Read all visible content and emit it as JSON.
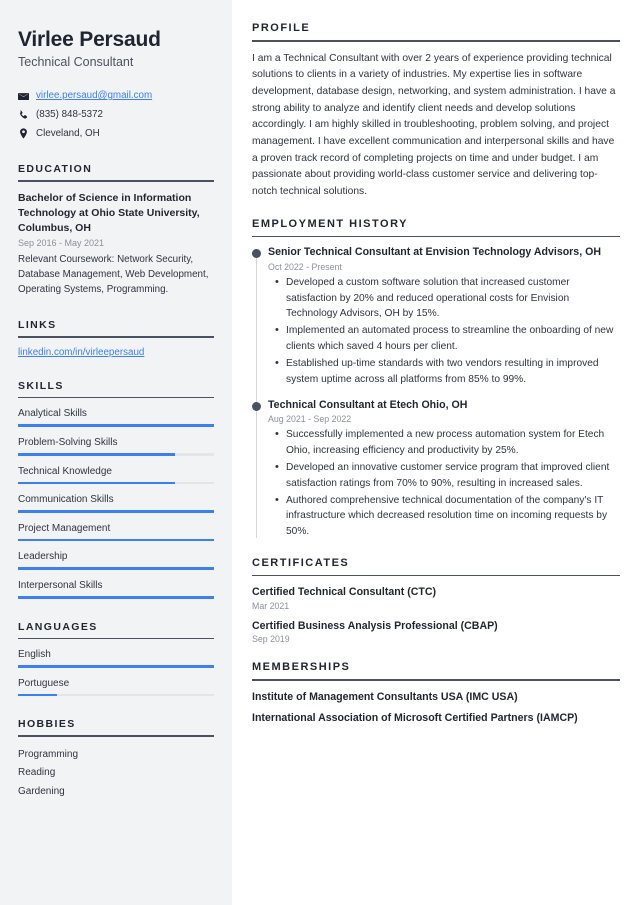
{
  "accent_color": "#3b7ff0",
  "sidebar_bg": "#f2f3f5",
  "text_color": "#2e3440",
  "header": {
    "name": "Virlee Persaud",
    "job_title": "Technical Consultant"
  },
  "contact": {
    "email": "virlee.persaud@gmail.com",
    "email_icon": "envelope-icon",
    "phone": "(835) 848-5372",
    "phone_icon": "phone-icon",
    "location": "Cleveland, OH",
    "location_icon": "map-pin-icon"
  },
  "education": {
    "heading": "EDUCATION",
    "degree": "Bachelor of Science in Information Technology at Ohio State University, Columbus, OH",
    "date": "Sep 2016 - May 2021",
    "description": "Relevant Coursework: Network Security, Database Management, Web Development, Operating Systems, Programming."
  },
  "links": {
    "heading": "LINKS",
    "items": [
      {
        "label": "linkedin.com/in/virleepersaud"
      }
    ]
  },
  "skills": {
    "heading": "SKILLS",
    "items": [
      {
        "label": "Analytical Skills",
        "level": 100
      },
      {
        "label": "Problem-Solving Skills",
        "level": 80
      },
      {
        "label": "Technical Knowledge",
        "level": 80
      },
      {
        "label": "Communication Skills",
        "level": 100
      },
      {
        "label": "Project Management",
        "level": 100
      },
      {
        "label": "Leadership",
        "level": 100
      },
      {
        "label": "Interpersonal Skills",
        "level": 100
      }
    ]
  },
  "languages": {
    "heading": "LANGUAGES",
    "items": [
      {
        "label": "English",
        "level": 100
      },
      {
        "label": "Portuguese",
        "level": 20
      }
    ]
  },
  "hobbies": {
    "heading": "HOBBIES",
    "items": [
      {
        "label": "Programming"
      },
      {
        "label": "Reading"
      },
      {
        "label": "Gardening"
      }
    ]
  },
  "profile": {
    "heading": "PROFILE",
    "text": "I am a Technical Consultant with over 2 years of experience providing technical solutions to clients in a variety of industries. My expertise lies in software development, database design, networking, and system administration. I have a strong ability to analyze and identify client needs and develop solutions accordingly. I am highly skilled in troubleshooting, problem solving, and project management. I have excellent communication and interpersonal skills and have a proven track record of completing projects on time and under budget. I am passionate about providing world-class customer service and delivering top-notch technical solutions."
  },
  "employment": {
    "heading": "EMPLOYMENT HISTORY",
    "jobs": [
      {
        "title": "Senior Technical Consultant at Envision Technology Advisors, OH",
        "date": "Oct 2022 - Present",
        "bullets": [
          "Developed a custom software solution that increased customer satisfaction by 20% and reduced operational costs for Envision Technology Advisors, OH by 15%.",
          "Implemented an automated process to streamline the onboarding of new clients which saved 4 hours per client.",
          "Established up-time standards with two vendors resulting in improved system uptime across all platforms from 85% to 99%."
        ]
      },
      {
        "title": "Technical Consultant at Etech Ohio, OH",
        "date": "Aug 2021 - Sep 2022",
        "bullets": [
          "Successfully implemented a new process automation system for Etech Ohio, increasing efficiency and productivity by 25%.",
          "Developed an innovative customer service program that improved client satisfaction ratings from 70% to 90%, resulting in increased sales.",
          "Authored comprehensive technical documentation of the company's IT infrastructure which decreased resolution time on incoming requests by 50%."
        ]
      }
    ]
  },
  "certificates": {
    "heading": "CERTIFICATES",
    "items": [
      {
        "name": "Certified Technical Consultant (CTC)",
        "date": "Mar 2021"
      },
      {
        "name": "Certified Business Analysis Professional (CBAP)",
        "date": "Sep 2019"
      }
    ]
  },
  "memberships": {
    "heading": "MEMBERSHIPS",
    "items": [
      {
        "name": "Institute of Management Consultants USA (IMC USA)"
      },
      {
        "name": "International Association of Microsoft Certified Partners (IAMCP)"
      }
    ]
  }
}
